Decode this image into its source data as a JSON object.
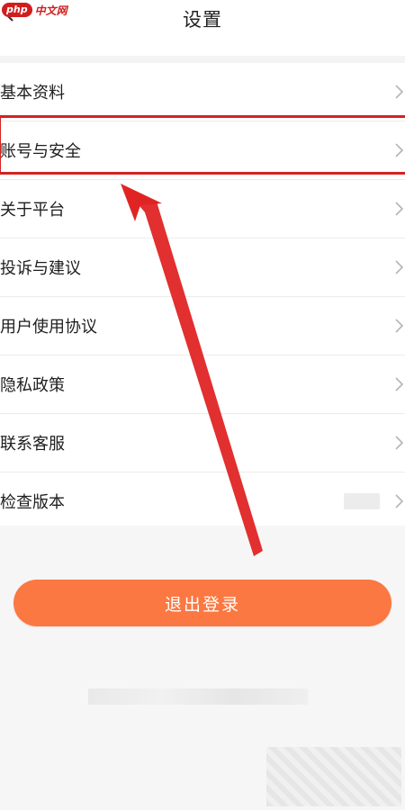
{
  "header": {
    "title": "设置",
    "watermark": {
      "badge": "php",
      "text": "中文网"
    }
  },
  "menu": {
    "items": [
      {
        "label": "基本资料"
      },
      {
        "label": "账号与安全"
      },
      {
        "label": "关于平台"
      },
      {
        "label": "投诉与建议"
      },
      {
        "label": "用户使用协议"
      },
      {
        "label": "隐私政策"
      },
      {
        "label": "联系客服"
      },
      {
        "label": "检查版本"
      }
    ]
  },
  "logout_label": "退出登录",
  "colors": {
    "accent": "#fb7842",
    "annotation": "#d42222"
  },
  "icons": [
    "back-arrow-icon",
    "chevron-right-icon",
    "annotation-arrow"
  ]
}
